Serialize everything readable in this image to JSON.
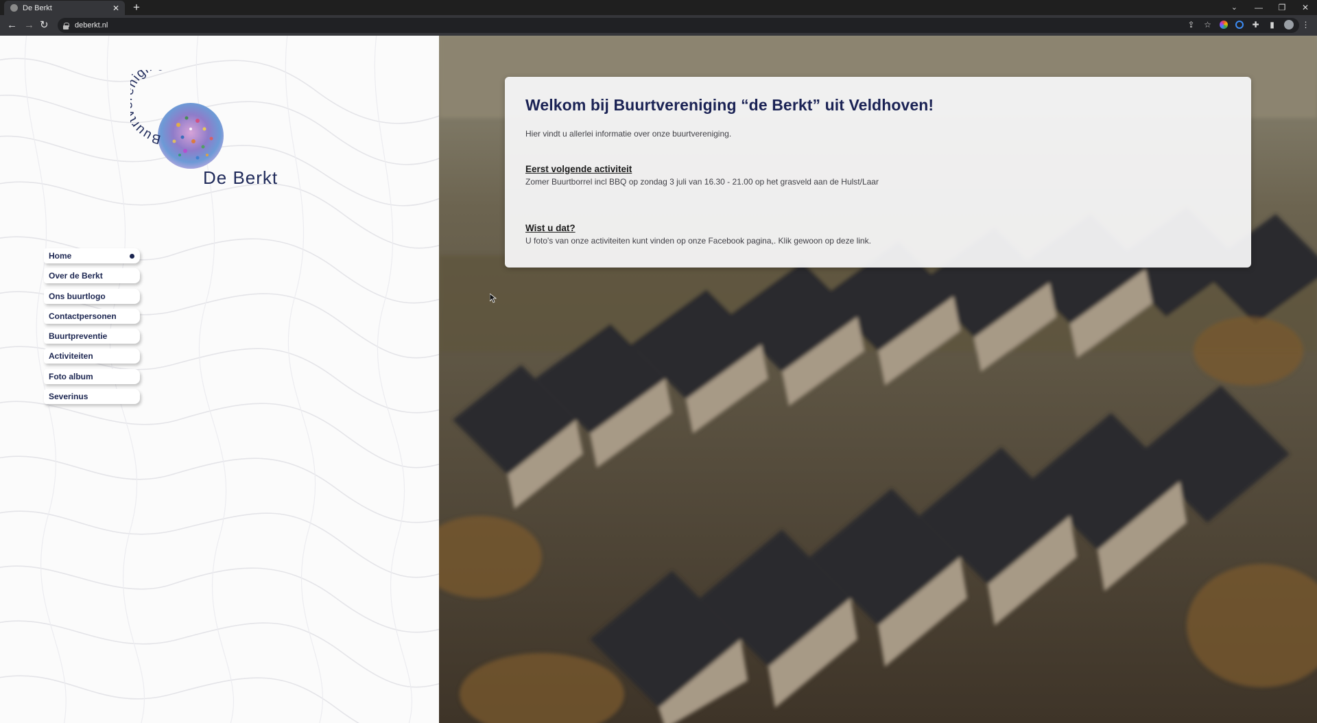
{
  "browser": {
    "tab_title": "De Berkt",
    "tab_close": "✕",
    "new_tab": "+",
    "url": "deberkt.nl",
    "nav": {
      "back": "←",
      "forward": "→",
      "reload": "↻"
    },
    "window_controls": {
      "tab_search": "⌄",
      "minimize": "—",
      "restore": "❐",
      "close": "✕"
    },
    "extensions": {
      "share": "⇪",
      "bookmark": "☆",
      "puzzle": "✚",
      "sidepanel": "▮",
      "menu": "⋮"
    }
  },
  "logo": {
    "arc_text": "Buurtvereniging",
    "name": "De Berkt"
  },
  "nav": {
    "items": [
      {
        "label": "Home",
        "active": true
      },
      {
        "label": "Over de Berkt"
      },
      {
        "label": "Ons buurtlogo"
      },
      {
        "label": "Contactpersonen"
      },
      {
        "label": "Buurtpreventie"
      },
      {
        "label": "Activiteiten"
      },
      {
        "label": "Foto album"
      },
      {
        "label": "Severinus"
      }
    ]
  },
  "welcome": {
    "title": "Welkom bij Buurtvereniging “de Berkt” uit Veldhoven!",
    "intro": "Hier vindt u allerlei informatie over onze buurtvereniging.",
    "next_activity_heading": "Eerst volgende activiteit",
    "next_activity_text": "Zomer Buurtborrel incl BBQ op zondag 3 juli van 16.30 - 21.00 op het grasveld aan de Hulst/Laar",
    "did_you_know_heading": "Wist u dat?",
    "did_you_know_text": "U foto's van onze activiteiten kunt vinden op onze Facebook pagina,. Klik gewoon op deze link."
  },
  "colors": {
    "navy": "#1b2550",
    "card_bg": "#f6f6f8",
    "chrome_dark": "#1f1f1f",
    "chrome_toolbar": "#35363a"
  }
}
